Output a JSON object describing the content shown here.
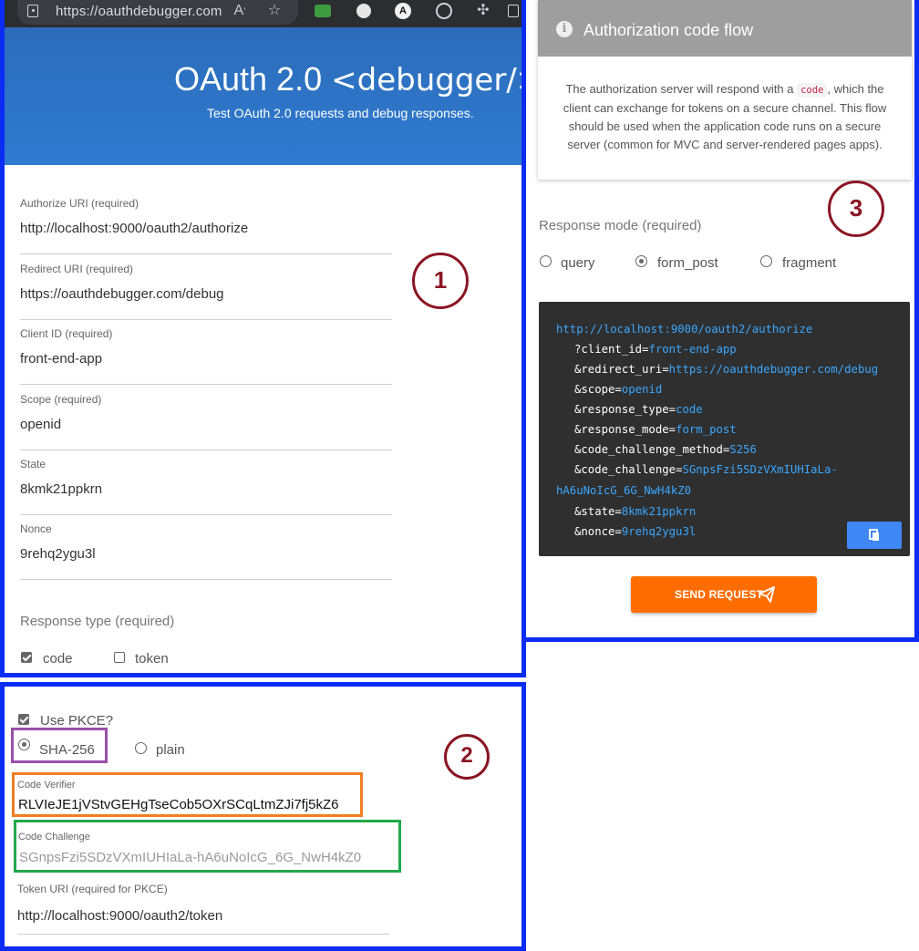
{
  "browser": {
    "url": "https://oauthdebugger.com",
    "icons": [
      "lock-icon",
      "read-aloud-icon",
      "favorite-star-icon",
      "extension-icon"
    ]
  },
  "hero": {
    "title_main": "OAuth 2.0",
    "title_tag": "<debugger/>",
    "subtitle": "Test OAuth 2.0 requests and debug responses."
  },
  "form": {
    "fields": [
      {
        "label": "Authorize URI (required)",
        "value": "http://localhost:9000/oauth2/authorize"
      },
      {
        "label": "Redirect URI (required)",
        "value": "https://oauthdebugger.com/debug"
      },
      {
        "label": "Client ID (required)",
        "value": "front-end-app"
      },
      {
        "label": "Scope (required)",
        "value": "openid"
      },
      {
        "label": "State",
        "value": "8kmk21ppkrn"
      },
      {
        "label": "Nonce",
        "value": "9rehq2ygu3l"
      }
    ],
    "response_type": {
      "label": "Response type (required)",
      "options": [
        {
          "label": "code",
          "checked": true
        },
        {
          "label": "token",
          "checked": false
        }
      ]
    }
  },
  "pkce": {
    "use_label": "Use PKCE?",
    "use_checked": true,
    "methods": [
      {
        "label": "SHA-256",
        "selected": true
      },
      {
        "label": "plain",
        "selected": false
      }
    ],
    "code_verifier_label": "Code Verifier",
    "code_verifier": "RLVIeJE1jVStvGEHgTseCob5OXrSCqLtmZJi7fj5kZ6",
    "code_challenge_label": "Code Challenge",
    "code_challenge": "SGnpsFzi5SDzVXmIUHIaLa-hA6uNoIcG_6G_NwH4kZ0",
    "token_uri_label": "Token URI (required for PKCE)",
    "token_uri": "http://localhost:9000/oauth2/token"
  },
  "flow_card": {
    "title": "Authorization code flow",
    "body_before": "The authorization server will respond with a ",
    "body_code": "code",
    "body_after": ", which the client can exchange for tokens on a secure channel. This flow should be used when the application code runs on a secure server (common for MVC and server-rendered pages apps)."
  },
  "response_mode": {
    "label": "Response mode (required)",
    "options": [
      {
        "label": "query",
        "selected": false
      },
      {
        "label": "form_post",
        "selected": true
      },
      {
        "label": "fragment",
        "selected": false
      }
    ]
  },
  "request_preview": {
    "base": "http://localhost:9000/oauth2/authorize",
    "params": [
      {
        "key": "?client_id=",
        "value": "front-end-app"
      },
      {
        "key": "&redirect_uri=",
        "value": "https://oauthdebugger.com/debug"
      },
      {
        "key": "&scope=",
        "value": "openid"
      },
      {
        "key": "&response_type=",
        "value": "code"
      },
      {
        "key": "&response_mode=",
        "value": "form_post"
      },
      {
        "key": "&code_challenge_method=",
        "value": "S256"
      },
      {
        "key": "&code_challenge=",
        "value": "SGnpsFzi5SDzVXmIUHIaLa-"
      },
      {
        "key": "",
        "value": "hA6uNoIcG_6G_NwH4kZ0"
      },
      {
        "key": "&state=",
        "value": "8kmk21ppkrn"
      },
      {
        "key": "&nonce=",
        "value": "9rehq2ygu3l"
      }
    ]
  },
  "send_button": {
    "label": "SEND REQUEST"
  },
  "annotations": {
    "n1": "1",
    "n2": "2",
    "n3": "3"
  },
  "colors": {
    "panel_border": "#0a2cf5",
    "annotation": "#8b1524",
    "sha_highlight": "#9b4fa8",
    "verifier_highlight": "#f07f22",
    "challenge_highlight": "#22a84a",
    "send_button": "#ff6d00",
    "code_value": "#3aa7ff"
  }
}
